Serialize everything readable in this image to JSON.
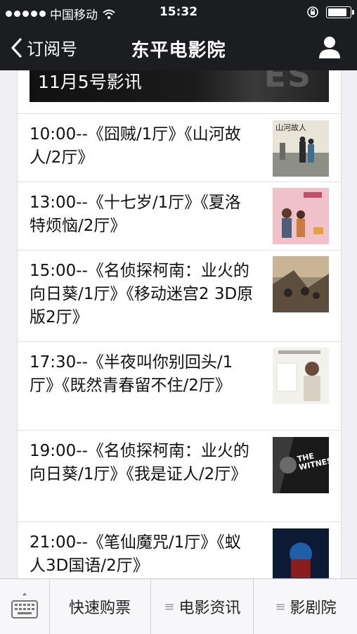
{
  "status": {
    "carrier": "中国移动",
    "time": "15:32"
  },
  "nav": {
    "back_label": "订阅号",
    "title": "东平电影院",
    "profile_icon": "person-icon"
  },
  "banner": {
    "title": "11月5号影讯"
  },
  "schedule": [
    {
      "text": "10:00--《囧贼/1厅》《山河故人/2厅》",
      "thumb_title": "山河故人"
    },
    {
      "text": "13:00--《十七岁/1厅》《夏洛特烦恼/2厅》",
      "thumb_title": ""
    },
    {
      "text": "15:00--《名侦探柯南：业火的向日葵/1厅》《移动迷宫2 3D原版2厅》",
      "thumb_title": ""
    },
    {
      "text": "17:30--《半夜叫你别回头/1厅》《既然青春留不住/2厅》",
      "thumb_title": ""
    },
    {
      "text": "19:00--《名侦探柯南：业火的向日葵/1厅》《我是证人/2厅》",
      "thumb_title": "THE WITNESS"
    },
    {
      "text": "21:00--《笔仙魔咒/1厅》《蚁人3D国语/2厅》",
      "thumb_title": ""
    }
  ],
  "bottom_bar": {
    "keyboard_icon": "keyboard-icon",
    "tabs": [
      {
        "label": "快速购票"
      },
      {
        "label": "电影资讯"
      },
      {
        "label": "影剧院"
      }
    ]
  },
  "colors": {
    "bar_dark": "#1c1d21",
    "background": "#efeff4",
    "text": "#111111"
  }
}
